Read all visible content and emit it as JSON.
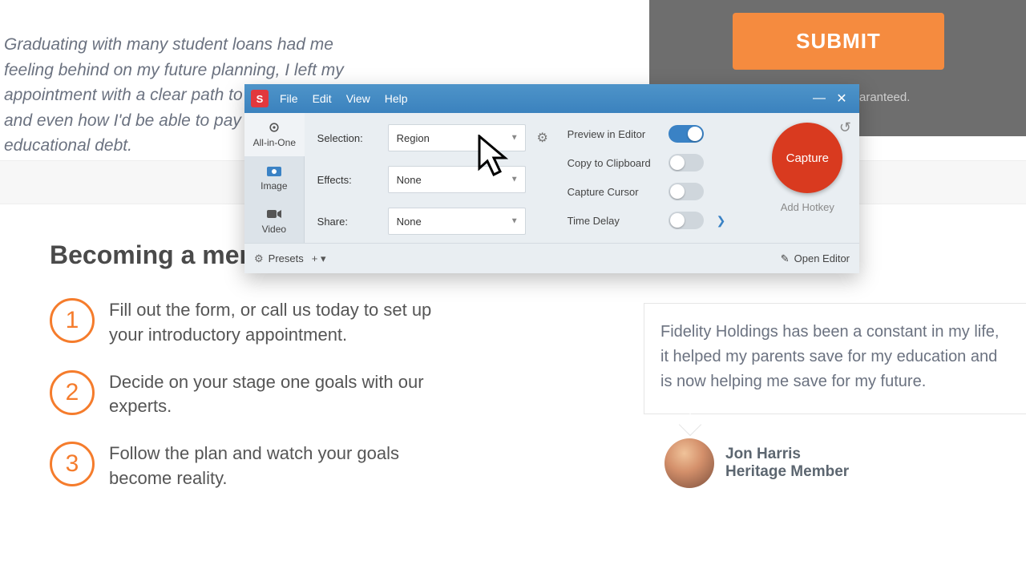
{
  "page": {
    "testimonial_top": "Graduating with many student loans had me feeling behind on my future planning, I left my appointment with a clear path to my retirement and even how I'd be able to pay down my educational debt.",
    "submit": "SUBMIT",
    "guaranteed": "aranteed.",
    "section_title": "Becoming a mem",
    "steps": [
      {
        "num": "1",
        "text": "Fill out the form, or call us today to set up your introductory appointment."
      },
      {
        "num": "2",
        "text": "Decide on your stage one goals with our experts."
      },
      {
        "num": "3",
        "text": "Follow the plan and watch your goals become reality."
      }
    ],
    "testimonial_card": "Fidelity Holdings has been a constant in my life, it helped my parents save for my education and is now helping me save for my future.",
    "author_name": "Jon Harris",
    "author_role": "Heritage Member"
  },
  "snagit": {
    "menu": {
      "file": "File",
      "edit": "Edit",
      "view": "View",
      "help": "Help"
    },
    "tabs": {
      "allinone": "All-in-One",
      "image": "Image",
      "video": "Video"
    },
    "labels": {
      "selection": "Selection:",
      "effects": "Effects:",
      "share": "Share:"
    },
    "dropdowns": {
      "selection": "Region",
      "effects": "None",
      "share": "None"
    },
    "toggles": {
      "preview": "Preview in Editor",
      "clipboard": "Copy to Clipboard",
      "cursor": "Capture Cursor",
      "delay": "Time Delay"
    },
    "capture": "Capture",
    "hotkey": "Add Hotkey",
    "presets": "Presets",
    "open_editor": "Open Editor"
  }
}
